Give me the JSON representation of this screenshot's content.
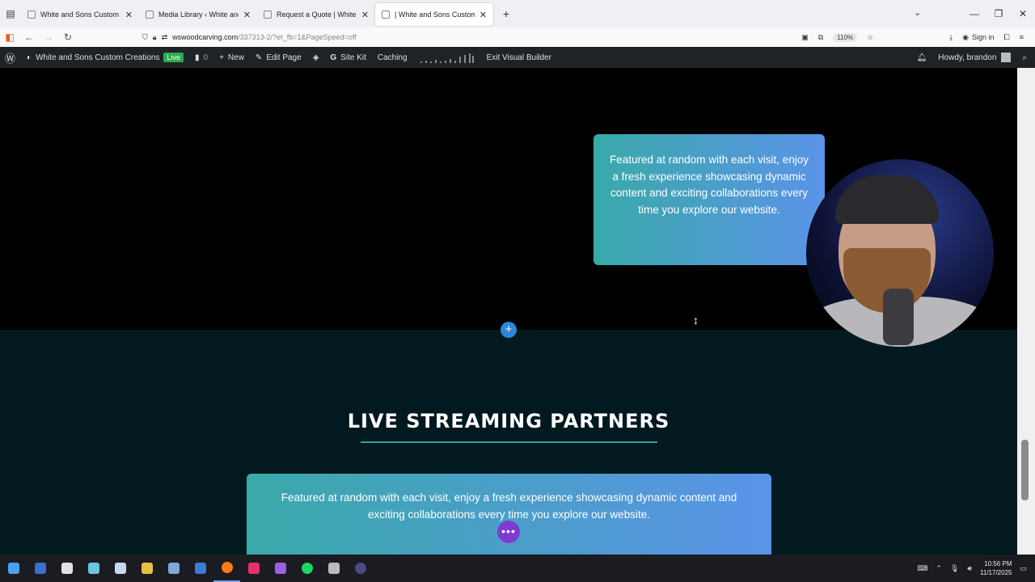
{
  "browser": {
    "tabs": [
      {
        "label": "White and Sons Custom Creatio",
        "active": false
      },
      {
        "label": "Media Library ‹ White and Sons",
        "active": false
      },
      {
        "label": "Request a Quote | White and S",
        "active": false
      },
      {
        "label": "| White and Sons Custom Creati",
        "active": true
      }
    ],
    "new_tab": "+",
    "url_main": "wswoodcarving.com",
    "url_rest": "/337313-2/?et_fb=1&PageSpeed=off",
    "zoom": "110%",
    "sign_in": "Sign in"
  },
  "adminbar": {
    "site_name": "White and Sons Custom Creations",
    "live_badge": "Live",
    "comments_count": "0",
    "new_label": "New",
    "edit_page": "Edit Page",
    "site_kit": "Site Kit",
    "caching": "Caching",
    "exit_builder": "Exit Visual Builder",
    "howdy": "Howdy, brandon"
  },
  "content": {
    "featured_text": "Featured at random with each visit, enjoy a fresh experience showcasing dynamic content and exciting collaborations every time you explore our website.",
    "partners_heading": "LIVE STREAMING PARTNERS",
    "partners_text": "Featured at random with each visit, enjoy a fresh experience showcasing dynamic content and exciting collaborations every time you explore our website.",
    "add_button": "+",
    "more_button": "•••"
  },
  "taskbar": {
    "time": "10:56 PM",
    "date": "11/17/2025",
    "icons": [
      "windows-start",
      "app-1",
      "app-2",
      "app-3",
      "notes",
      "file-explorer",
      "steam",
      "app-4",
      "firefox",
      "maps",
      "app-5",
      "spotify",
      "calculator",
      "app-6"
    ],
    "icon_colors": [
      "#4aa3f0",
      "#3b6fc8",
      "#e0e0e0",
      "#6cc3e0",
      "#c8d8f0",
      "#e8c040",
      "#7fa8d8",
      "#3a7bd5",
      "#ff7a1a",
      "#e8306a",
      "#9a60e0",
      "#1ed760",
      "#bbbbbb",
      "#4a4a8a"
    ]
  },
  "colors": {
    "accent": "#2aa6a0",
    "gradient_start": "#3aa9a9",
    "gradient_end": "#5a93e8",
    "add_button": "#2b87da",
    "more_button": "#7e3bd0"
  }
}
